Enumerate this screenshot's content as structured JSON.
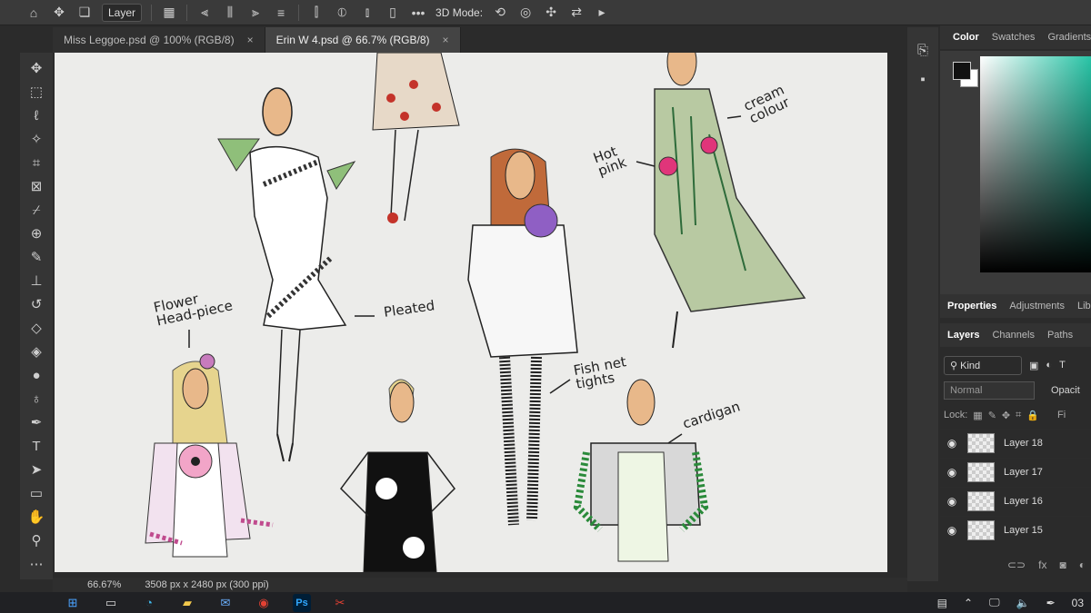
{
  "options_bar": {
    "layer_select": "Layer",
    "mode_label": "3D Mode:",
    "more": "•••"
  },
  "tabs": [
    {
      "label": "Miss Leggoe.psd @ 100% (RGB/8)",
      "close": "×"
    },
    {
      "label": "Erin W 4.psd @ 66.7% (RGB/8)",
      "close": "×"
    }
  ],
  "annotations": {
    "flower_head": "Flower\nHead-piece",
    "pleated": "Pleated",
    "fish_net": "Fish net\ntights",
    "hot_pink": "Hot\npink",
    "cream_colour": "cream\ncolour",
    "cardigan": "cardigan"
  },
  "color_panel": {
    "tabs": [
      "Color",
      "Swatches",
      "Gradients"
    ],
    "accent": "#28c4a6"
  },
  "properties_panel": {
    "tabs": [
      "Properties",
      "Adjustments",
      "Lib"
    ]
  },
  "layers_panel": {
    "tabs": [
      "Layers",
      "Channels",
      "Paths"
    ],
    "filter_kind": "Kind",
    "blend_mode": "Normal",
    "opacity_label": "Opacit",
    "lock_label": "Lock:",
    "fill_label": "Fi",
    "layers": [
      "Layer 18",
      "Layer 17",
      "Layer 16",
      "Layer 15"
    ]
  },
  "status_bar": {
    "zoom": "66.67%",
    "doc_size": "3508 px x 2480 px (300 ppi)"
  },
  "taskbar": {
    "ps_label": "Ps",
    "clock": "03"
  }
}
